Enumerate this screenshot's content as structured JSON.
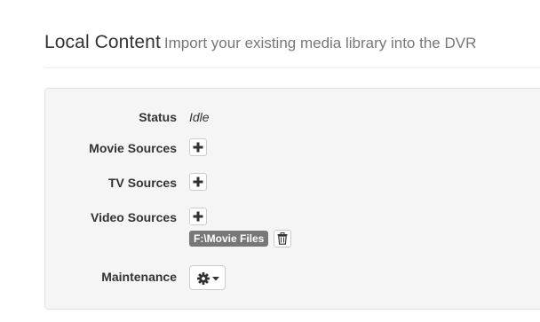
{
  "header": {
    "title": "Local Content",
    "subtitle": "Import your existing media library into the DVR"
  },
  "form": {
    "status": {
      "label": "Status",
      "value": "Idle"
    },
    "movie_sources": {
      "label": "Movie Sources",
      "add_icon": "plus-icon"
    },
    "tv_sources": {
      "label": "TV Sources",
      "add_icon": "plus-icon"
    },
    "video_sources": {
      "label": "Video Sources",
      "add_icon": "plus-icon",
      "paths": [
        "F:\\Movie Files"
      ],
      "remove_icon": "trash-icon"
    },
    "maintenance": {
      "label": "Maintenance",
      "menu_icon": "gear-icon",
      "caret_icon": "caret-down-icon"
    }
  },
  "colors": {
    "panel_background": "#f5f5f5",
    "tag_background": "#777777",
    "subtitle_text": "#777777"
  }
}
